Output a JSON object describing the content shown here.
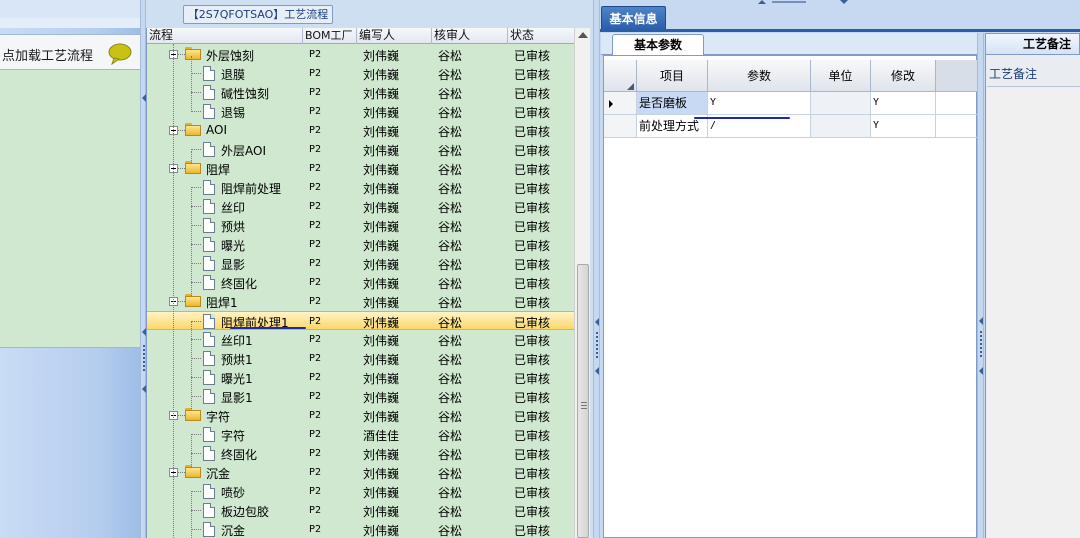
{
  "left": {
    "load_link": "点加载工艺流程"
  },
  "flow_title": "【2S7QFOTSAO】工艺流程",
  "tree": {
    "headers": [
      "流程",
      "BOM工厂",
      "编写人",
      "核审人",
      "状态"
    ],
    "rows": [
      {
        "name": "外层蚀刻",
        "type": "folder",
        "bom": "P2",
        "writer": "刘伟巍",
        "checker": "谷松",
        "status": "已审核"
      },
      {
        "name": "退膜",
        "type": "doc",
        "bom": "P2",
        "writer": "刘伟巍",
        "checker": "谷松",
        "status": "已审核"
      },
      {
        "name": "碱性蚀刻",
        "type": "doc",
        "bom": "P2",
        "writer": "刘伟巍",
        "checker": "谷松",
        "status": "已审核"
      },
      {
        "name": "退锡",
        "type": "doc",
        "bom": "P2",
        "writer": "刘伟巍",
        "checker": "谷松",
        "status": "已审核"
      },
      {
        "name": "AOI",
        "type": "folder",
        "bom": "P2",
        "writer": "刘伟巍",
        "checker": "谷松",
        "status": "已审核"
      },
      {
        "name": "外层AOI",
        "type": "doc",
        "bom": "P2",
        "writer": "刘伟巍",
        "checker": "谷松",
        "status": "已审核"
      },
      {
        "name": "阻焊",
        "type": "folder",
        "bom": "P2",
        "writer": "刘伟巍",
        "checker": "谷松",
        "status": "已审核"
      },
      {
        "name": "阻焊前处理",
        "type": "doc",
        "bom": "P2",
        "writer": "刘伟巍",
        "checker": "谷松",
        "status": "已审核"
      },
      {
        "name": "丝印",
        "type": "doc",
        "bom": "P2",
        "writer": "刘伟巍",
        "checker": "谷松",
        "status": "已审核"
      },
      {
        "name": "预烘",
        "type": "doc",
        "bom": "P2",
        "writer": "刘伟巍",
        "checker": "谷松",
        "status": "已审核"
      },
      {
        "name": "曝光",
        "type": "doc",
        "bom": "P2",
        "writer": "刘伟巍",
        "checker": "谷松",
        "status": "已审核"
      },
      {
        "name": "显影",
        "type": "doc",
        "bom": "P2",
        "writer": "刘伟巍",
        "checker": "谷松",
        "status": "已审核"
      },
      {
        "name": "终固化",
        "type": "doc",
        "bom": "P2",
        "writer": "刘伟巍",
        "checker": "谷松",
        "status": "已审核"
      },
      {
        "name": "阻焊1",
        "type": "folder",
        "bom": "P2",
        "writer": "刘伟巍",
        "checker": "谷松",
        "status": "已审核"
      },
      {
        "name": "阻焊前处理1",
        "type": "doc",
        "bom": "P2",
        "writer": "刘伟巍",
        "checker": "谷松",
        "status": "已审核",
        "selected": true
      },
      {
        "name": "丝印1",
        "type": "doc",
        "bom": "P2",
        "writer": "刘伟巍",
        "checker": "谷松",
        "status": "已审核"
      },
      {
        "name": "预烘1",
        "type": "doc",
        "bom": "P2",
        "writer": "刘伟巍",
        "checker": "谷松",
        "status": "已审核"
      },
      {
        "name": "曝光1",
        "type": "doc",
        "bom": "P2",
        "writer": "刘伟巍",
        "checker": "谷松",
        "status": "已审核"
      },
      {
        "name": "显影1",
        "type": "doc",
        "bom": "P2",
        "writer": "刘伟巍",
        "checker": "谷松",
        "status": "已审核"
      },
      {
        "name": "字符",
        "type": "folder",
        "bom": "P2",
        "writer": "刘伟巍",
        "checker": "谷松",
        "status": "已审核"
      },
      {
        "name": "字符",
        "type": "doc",
        "bom": "P2",
        "writer": "酒佳佳",
        "checker": "谷松",
        "status": "已审核"
      },
      {
        "name": "终固化",
        "type": "doc",
        "bom": "P2",
        "writer": "刘伟巍",
        "checker": "谷松",
        "status": "已审核"
      },
      {
        "name": "沉金",
        "type": "folder",
        "bom": "P2",
        "writer": "刘伟巍",
        "checker": "谷松",
        "status": "已审核"
      },
      {
        "name": "喷砂",
        "type": "doc",
        "bom": "P2",
        "writer": "刘伟巍",
        "checker": "谷松",
        "status": "已审核"
      },
      {
        "name": "板边包胶",
        "type": "doc",
        "bom": "P2",
        "writer": "刘伟巍",
        "checker": "谷松",
        "status": "已审核"
      },
      {
        "name": "沉金",
        "type": "doc",
        "bom": "P2",
        "writer": "刘伟巍",
        "checker": "谷松",
        "status": "已审核"
      }
    ]
  },
  "right": {
    "main_tab": "基本信息",
    "params_tab": "基本参数",
    "remark_tab": "工艺备注",
    "remark_label": "工艺备注",
    "grid_headers": [
      "项目",
      "参数",
      "单位",
      "修改"
    ],
    "grid_rows": [
      {
        "item": "是否磨板",
        "param": "Y",
        "unit": "",
        "modify": "Y"
      },
      {
        "item": "前处理方式",
        "param": "/",
        "unit": "",
        "modify": "Y"
      }
    ]
  }
}
